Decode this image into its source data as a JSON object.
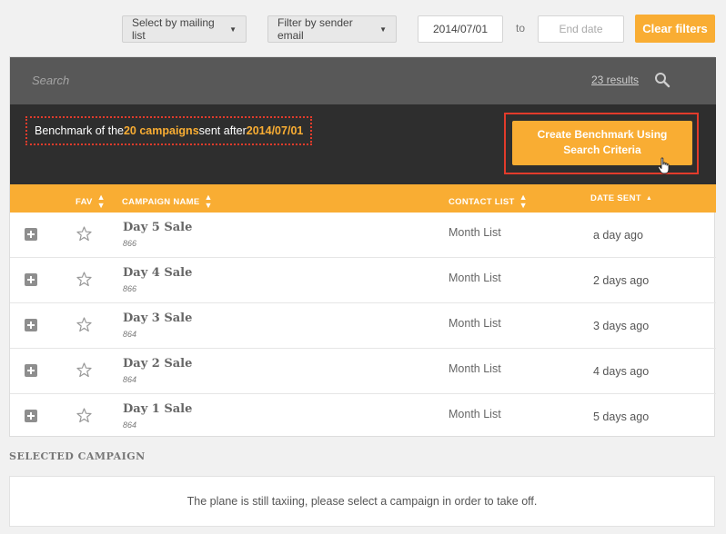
{
  "filters": {
    "mailing_list": "Select by mailing list",
    "sender_email": "Filter by sender email",
    "start_date": "2014/07/01",
    "to": "to",
    "end_date_placeholder": "End date",
    "clear": "Clear filters"
  },
  "search": {
    "placeholder": "Search",
    "results": "23 results"
  },
  "benchmark": {
    "prefix": "Benchmark of the ",
    "count": "20 campaigns",
    "middle": " sent after ",
    "date": "2014/07/01",
    "button_line1": "Create Benchmark Using",
    "button_line2": "Search Criteria"
  },
  "table": {
    "headers": {
      "fav": "FAV",
      "name": "CAMPAIGN NAME",
      "list": "CONTACT LIST",
      "date": "DATE SENT"
    },
    "rows": [
      {
        "name": "Day 5 Sale",
        "id": "866",
        "list": "Month List",
        "sent": "a day ago"
      },
      {
        "name": "Day 4 Sale",
        "id": "866",
        "list": "Month List",
        "sent": "2 days ago"
      },
      {
        "name": "Day 3 Sale",
        "id": "864",
        "list": "Month List",
        "sent": "3 days ago"
      },
      {
        "name": "Day 2 Sale",
        "id": "864",
        "list": "Month List",
        "sent": "4 days ago"
      },
      {
        "name": "Day 1 Sale",
        "id": "864",
        "list": "Month List",
        "sent": "5 days ago"
      }
    ]
  },
  "selected": {
    "label": "SELECTED CAMPAIGN",
    "message": "The plane is still taxiing, please select a campaign in order to take off."
  },
  "colors": {
    "accent": "#f9ad33",
    "dark": "#2e2e2e",
    "search_bar": "#585858",
    "highlight_border": "#e23b2b"
  },
  "icons": {
    "expand": "plus-icon",
    "favorite": "star-icon",
    "search": "search-icon",
    "cursor": "hand-cursor-icon"
  }
}
